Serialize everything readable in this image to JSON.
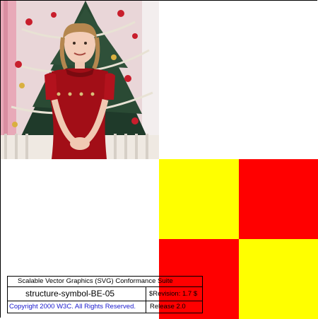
{
  "image": {
    "alt": ""
  },
  "pattern": {
    "colors": {
      "top_left": "#ffff00",
      "top_right": "#ff0000",
      "bottom_left": "#ff0000",
      "bottom_right": "#ffff00"
    }
  },
  "legend": {
    "suite_title": "Scalable Vector Graphics (SVG) Conformance Suite",
    "test_name": "structure-symbol-BE-05",
    "revision": "$Revision: 1.7 $",
    "copyright": "Copyright 2000 W3C. All Rights Reserved.",
    "release": "Release 2.0"
  }
}
